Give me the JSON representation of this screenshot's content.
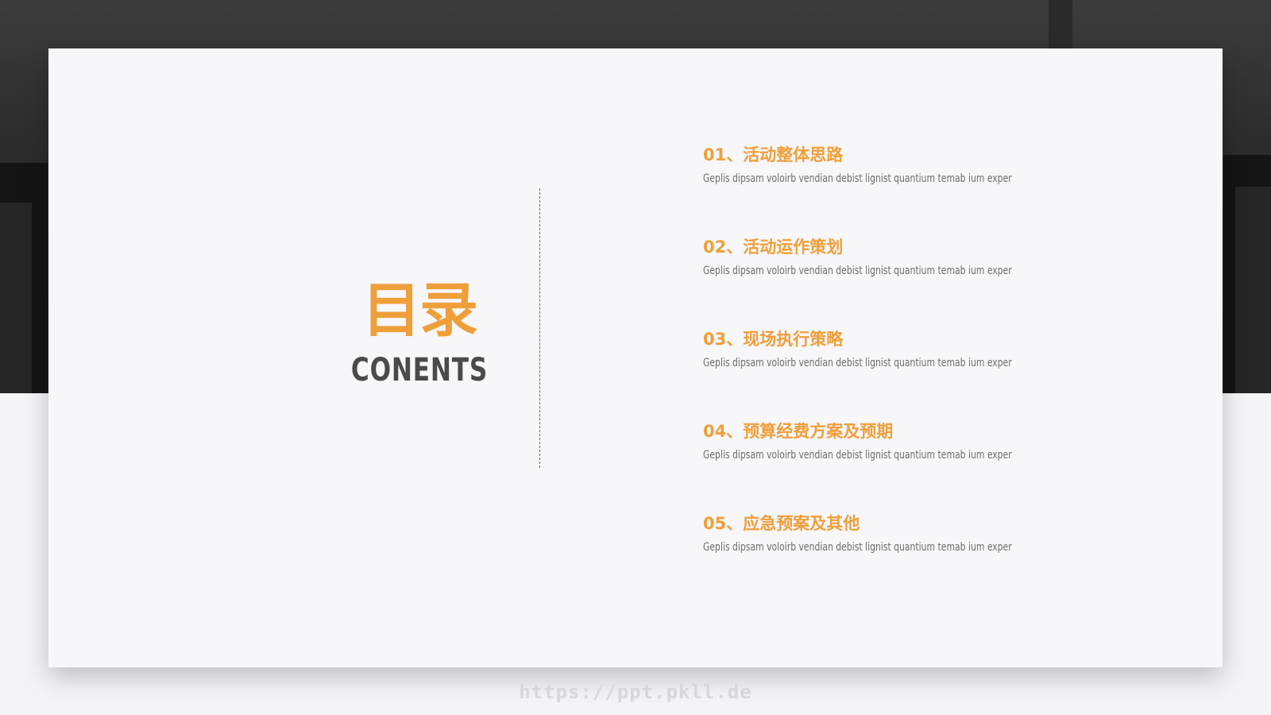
{
  "slide": {
    "title_zh": "目录",
    "title_en": "CONENTS",
    "items": [
      {
        "title": "01、活动整体思路",
        "desc": "Geplis dipsam voloirb vendian debist lignist quantium temab ium exper"
      },
      {
        "title": "02、活动运作策划",
        "desc": "Geplis dipsam voloirb vendian debist lignist quantium temab ium exper"
      },
      {
        "title": "03、现场执行策略",
        "desc": "Geplis dipsam voloirb vendian debist lignist quantium temab ium exper"
      },
      {
        "title": "04、预算经费方案及预期",
        "desc": "Geplis dipsam voloirb vendian debist lignist quantium temab ium exper"
      },
      {
        "title": "05、应急预案及其他",
        "desc": "Geplis dipsam voloirb vendian debist lignist quantium temab ium exper"
      }
    ]
  },
  "watermark": "https://ppt.pkll.de",
  "colors": {
    "accent": "#ef9f3a",
    "heading_dark": "#4a4a4a",
    "body_text": "#6e6e6e",
    "card_bg": "#f7f6f8",
    "background_dark": "#2d2d2e"
  }
}
